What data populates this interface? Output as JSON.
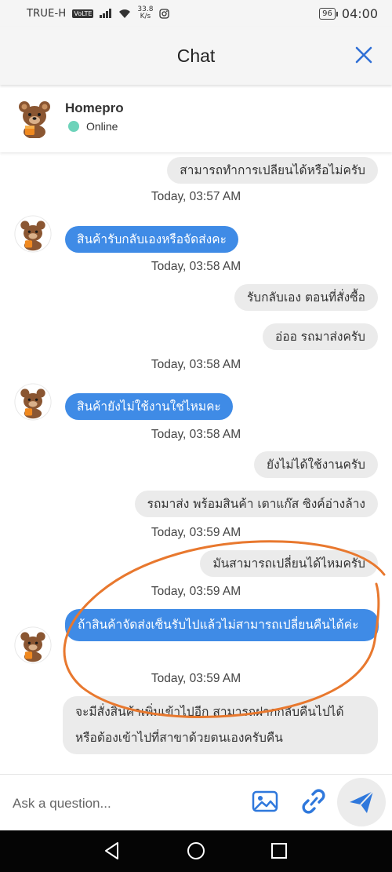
{
  "status_bar": {
    "carrier": "TRUE-H",
    "volte": "VoLTE",
    "speed_value": "33.8",
    "speed_unit": "K/s",
    "battery": "96",
    "time": "04:00"
  },
  "header": {
    "title": "Chat"
  },
  "agent": {
    "name": "Homepro",
    "status": "Online"
  },
  "messages": [
    {
      "side": "out",
      "text": "สามารถทำการเปลียนได้หรือไม่ครับ"
    },
    {
      "side": "in",
      "text": "สินค้ารับกลับเองหรือจัดส่งคะ"
    },
    {
      "side": "out",
      "text": "รับกลับเอง ตอนที่สั่งซื้อ"
    },
    {
      "side": "out",
      "text": "อ่ออ  รถมาส่งครับ"
    },
    {
      "side": "in",
      "text": "สินค้ายังไม่ใช้งานใช่ไหมคะ"
    },
    {
      "side": "out",
      "text": "ยังไม่ได้ใช้งานครับ"
    },
    {
      "side": "out",
      "text": "รถมาส่ง พร้อมสินค้า เตาแก๊ส   ซิงค์อ่างล้าง"
    },
    {
      "side": "out",
      "text": "มันสามารถเปลี่ยนได้ไหมครับ"
    },
    {
      "side": "in",
      "text": "ถ้าสินค้าจัดส่งเซ็นรับไปแล้วไม่สามารถเปลี่ยนคืนได้ค่ะ"
    },
    {
      "side": "out",
      "text": "จะมีสั่งสินค้าเพิ่มเข้าไปอีก  สามารถฝากกลับคืนไปได้  หรือต้องเข้าไปที่สาขาด้วยตนเองครับคืน"
    }
  ],
  "timestamps": [
    "Today, 03:57 AM",
    "Today, 03:58 AM",
    "Today, 03:58 AM",
    "Today, 03:58 AM",
    "Today, 03:59 AM",
    "Today, 03:59 AM",
    "Today, 03:59 AM"
  ],
  "input": {
    "placeholder": "Ask a question..."
  },
  "icons": {
    "close": "close-icon",
    "image": "image-icon",
    "link": "link-icon",
    "send": "send-icon",
    "back": "back-icon",
    "home": "home-icon",
    "recents": "recents-icon"
  },
  "colors": {
    "accent": "#3f8be6",
    "incoming_bubble": "#3f8be6",
    "outgoing_bubble": "#ebebeb",
    "online": "#6dd3ba",
    "annotation": "#e8782e"
  }
}
